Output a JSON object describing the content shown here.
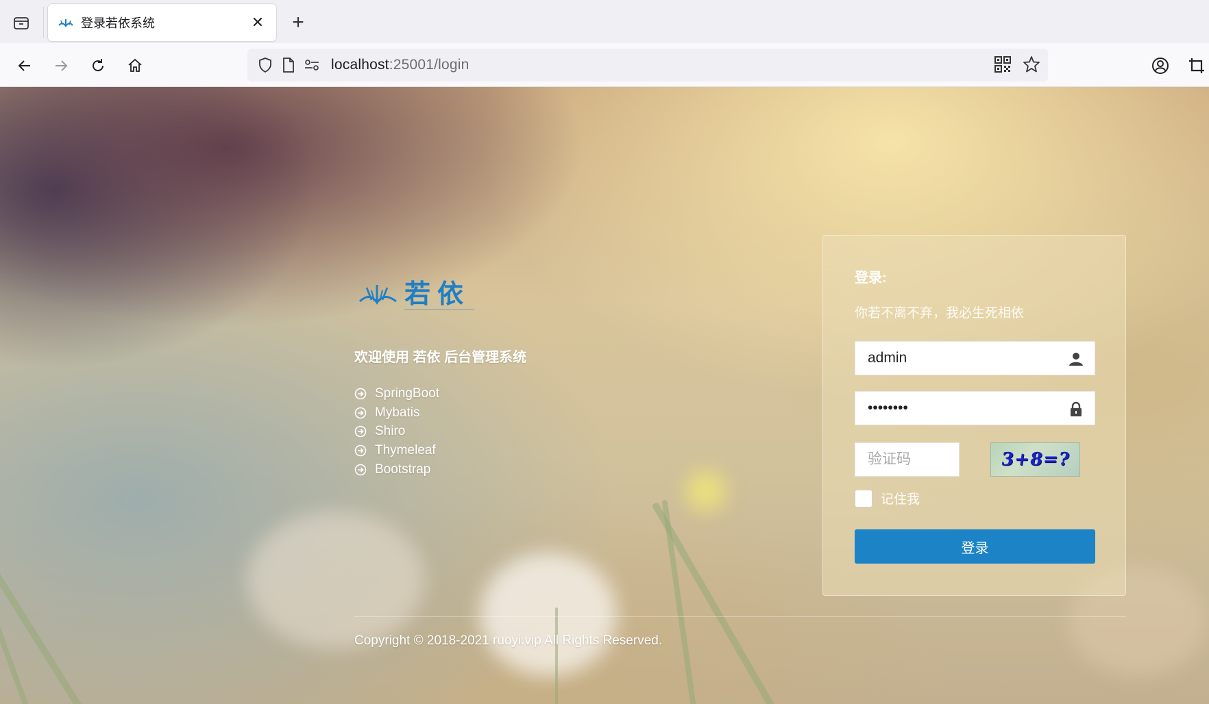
{
  "browser": {
    "tab": {
      "title": "登录若依系统",
      "close_glyph": "✕"
    },
    "new_tab_glyph": "+",
    "url": {
      "host": "localhost",
      "rest": ":25001/login"
    }
  },
  "page": {
    "logo_alt": "若依",
    "welcome": "欢迎使用 若依 后台管理系统",
    "tech_stack": [
      "SpringBoot",
      "Mybatis",
      "Shiro",
      "Thymeleaf",
      "Bootstrap"
    ],
    "login": {
      "title": "登录:",
      "subtitle": "你若不离不弃，我必生死相依",
      "username_value": "admin",
      "password_value": "admin123",
      "captcha_placeholder": "验证码",
      "captcha_text": "3+8=?",
      "remember_label": "记住我",
      "submit_label": "登录"
    },
    "copyright": "Copyright © 2018-2021 ruoyi.vip All Rights Reserved."
  },
  "colors": {
    "primary": "#1c84c6",
    "logo_blue": "#1f7fc4"
  }
}
